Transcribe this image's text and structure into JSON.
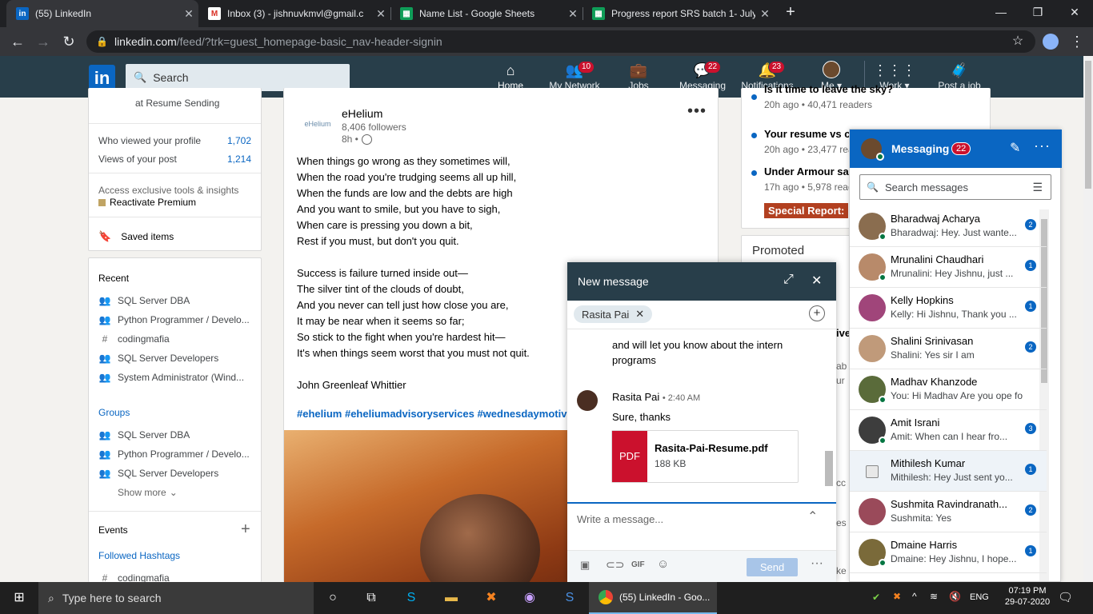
{
  "browser": {
    "tabs": [
      {
        "title": "(55) LinkedIn",
        "icon": "linkedin-icon",
        "active": true
      },
      {
        "title": "Inbox (3) - jishnuvkmvl@gmail.c",
        "icon": "gmail-icon",
        "active": false
      },
      {
        "title": "Name List - Google Sheets",
        "icon": "sheets-icon",
        "active": false
      },
      {
        "title": "Progress report SRS batch 1- July",
        "icon": "sheets-icon",
        "active": false
      }
    ],
    "url_host": "linkedin.com",
    "url_path": "/feed/?trk=guest_homepage-basic_nav-header-signin"
  },
  "header": {
    "search_placeholder": "Search",
    "nav": [
      {
        "label": "Home",
        "icon": "home-icon",
        "badge": ""
      },
      {
        "label": "My Network",
        "icon": "network-icon",
        "badge": "10"
      },
      {
        "label": "Jobs",
        "icon": "jobs-icon",
        "badge": ""
      },
      {
        "label": "Messaging",
        "icon": "messaging-icon",
        "badge": "22"
      },
      {
        "label": "Notifications",
        "icon": "bell-icon",
        "badge": "23"
      },
      {
        "label": "Me ▾",
        "icon": "avatar",
        "badge": ""
      },
      {
        "label": "Work ▾",
        "icon": "grid-icon",
        "badge": ""
      },
      {
        "label": "Post a job",
        "icon": "briefcase-icon",
        "badge": ""
      }
    ]
  },
  "left": {
    "headline_tail": "at Resume Sending",
    "stats": [
      {
        "label": "Who viewed your profile",
        "value": "1,702"
      },
      {
        "label": "Views of your post",
        "value": "1,214"
      }
    ],
    "premium_text": "Access exclusive tools & insights",
    "premium_link": "Reactivate Premium",
    "saved_items": "Saved items",
    "recent_title": "Recent",
    "recent": [
      {
        "icon": "group-icon",
        "label": "SQL Server DBA"
      },
      {
        "icon": "group-icon",
        "label": "Python Programmer / Develo..."
      },
      {
        "icon": "hashtag-icon",
        "label": "codingmafia"
      },
      {
        "icon": "group-icon",
        "label": "SQL Server Developers"
      },
      {
        "icon": "group-icon",
        "label": "System Administrator (Wind..."
      }
    ],
    "groups_title": "Groups",
    "groups": [
      {
        "label": "SQL Server DBA"
      },
      {
        "label": "Python Programmer / Develo..."
      },
      {
        "label": "SQL Server Developers"
      }
    ],
    "show_more": "Show more",
    "events_title": "Events",
    "hashtags_title": "Followed Hashtags",
    "hashtag_first": "codingmafia"
  },
  "post": {
    "author": "eHelium",
    "logo_text": "eHelium",
    "followers": "8,406 followers",
    "time": "8h •",
    "lines": [
      "When things go wrong as they sometimes will,",
      "When the road you're trudging seems all up hill,",
      "When the funds are low and the debts are high",
      "And you want to smile, but you have to sigh,",
      "When care is pressing you down a bit,",
      "Rest if you must, but don't you quit.",
      "",
      "Success is failure turned inside out—",
      "The silver tint of the clouds of doubt,",
      "And you never can tell just how close you are,",
      "It may be near when it seems so far;",
      "So stick to the fight when you're hardest hit—",
      "It's when things seem worst that you must not quit.",
      "",
      "John Greenleaf Whittier"
    ],
    "hashtags": "#ehelium #eheliumadvisoryservices #wednesdaymotiv"
  },
  "right": {
    "news": [
      {
        "headline": "Is it time to leave the sky?",
        "meta": "20h ago • 40,471 readers"
      },
      {
        "headline": "Your resume vs co",
        "meta": "20h ago • 23,477 rea"
      },
      {
        "headline": "Under Armour sa",
        "meta": "17h ago • 5,978 read"
      }
    ],
    "special_report": "Special Report:",
    "promoted": "Promoted",
    "frag1": "ive",
    "frag2": "ab",
    "frag3": "ur",
    "frag4": "cc",
    "frag5": "es",
    "frag6": "ke"
  },
  "messaging": {
    "title": "Messaging",
    "badge": "22",
    "search_placeholder": "Search messages",
    "conversations": [
      {
        "name": "Bharadwaj Acharya",
        "preview": "Bharadwaj: Hey. Just wante...",
        "badge": "2",
        "color": "#8a6d4f",
        "online": true
      },
      {
        "name": "Mrunalini Chaudhari",
        "preview": "Mrunalini: Hey Jishnu, just ...",
        "badge": "1",
        "color": "#b88a6a",
        "online": true
      },
      {
        "name": "Kelly Hopkins",
        "preview": "Kelly: Hi Jishnu, Thank you ...",
        "badge": "1",
        "color": "#a0457a",
        "online": false
      },
      {
        "name": "Shalini Srinivasan",
        "preview": "Shalini: Yes sir I am",
        "badge": "2",
        "color": "#c09a7a",
        "online": false
      },
      {
        "name": "Madhav Khanzode",
        "preview": "You: Hi Madhav Are you ope fo...",
        "badge": "",
        "color": "#5a6b3a",
        "online": true
      },
      {
        "name": "Amit Israni",
        "preview": "Amit: When can I hear fro...",
        "badge": "3",
        "color": "#3d3d3d",
        "online": true
      },
      {
        "name": "Mithilesh Kumar",
        "preview": "Mithilesh: Hey Just sent yo...",
        "badge": "1",
        "color": "#e8e8e8",
        "online": false
      },
      {
        "name": "Sushmita Ravindranath...",
        "preview": "Sushmita: Yes",
        "badge": "2",
        "color": "#9a4a5a",
        "online": false
      },
      {
        "name": "Dmaine Harris",
        "preview": "Dmaine: Hey Jishnu, I hope...",
        "badge": "1",
        "color": "#7a6a3a",
        "online": true
      }
    ]
  },
  "new_message": {
    "title": "New message",
    "recipient": "Rasita Pai",
    "prev_text_1": "and will let you know about the intern",
    "prev_text_2": "programs",
    "sender": "Rasita Pai",
    "sent_time": "• 2:40 AM",
    "message": "Sure, thanks",
    "file_name": "Rasita-Pai-Resume.pdf",
    "file_size": "188 KB",
    "file_type": "PDF",
    "compose_placeholder": "Write a message...",
    "send_label": "Send"
  },
  "taskbar": {
    "search_placeholder": "Type here to search",
    "active_app": "(55) LinkedIn - Goo...",
    "language": "ENG",
    "time": "07:19 PM",
    "date": "29-07-2020"
  },
  "colors": {
    "linkedin_header": "#283e4a",
    "accent_blue": "#0a66c2",
    "badge_red": "#cb112d",
    "special_report": "#b24020"
  }
}
